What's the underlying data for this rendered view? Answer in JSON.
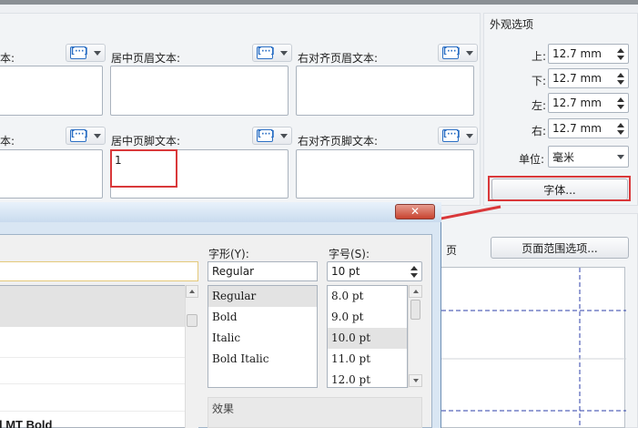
{
  "headers": {
    "left_label": "本:",
    "center_label": "居中页眉文本:",
    "right_label": "右对齐页眉文本:"
  },
  "footers": {
    "left_label": "本:",
    "center_label": "居中页脚文本:",
    "center_value": "1",
    "right_label": "右对齐页脚文本:"
  },
  "insert_icon_glyph": "[···]",
  "appearance": {
    "title": "外观选项",
    "top_label": "上:",
    "top_value": "12.7 mm",
    "bottom_label": "下:",
    "bottom_value": "12.7 mm",
    "left_label": "左:",
    "left_value": "12.7 mm",
    "right_label": "右:",
    "right_value": "12.7 mm",
    "unit_label": "单位:",
    "unit_value": "毫米",
    "font_button": "字体..."
  },
  "preview": {
    "page_label": "页",
    "page_range_button": "页面范围选项..."
  },
  "font_dialog": {
    "close_glyph": "✕",
    "style_label": "字形(Y):",
    "style_value": "Regular",
    "style_items": [
      "Regular",
      "Bold",
      "Italic",
      "Bold Italic"
    ],
    "size_label": "字号(S):",
    "size_value": "10 pt",
    "size_items": [
      "8.0 pt",
      "9.0 pt",
      "10.0 pt",
      "11.0 pt",
      "12.0 pt"
    ],
    "effects_label": "效果",
    "font_list_partial": "l MT Bold"
  },
  "colors": {
    "highlight": "#d9383a",
    "accent_blue": "#2b6fc4",
    "preview_dash": "#2c3fa8"
  }
}
